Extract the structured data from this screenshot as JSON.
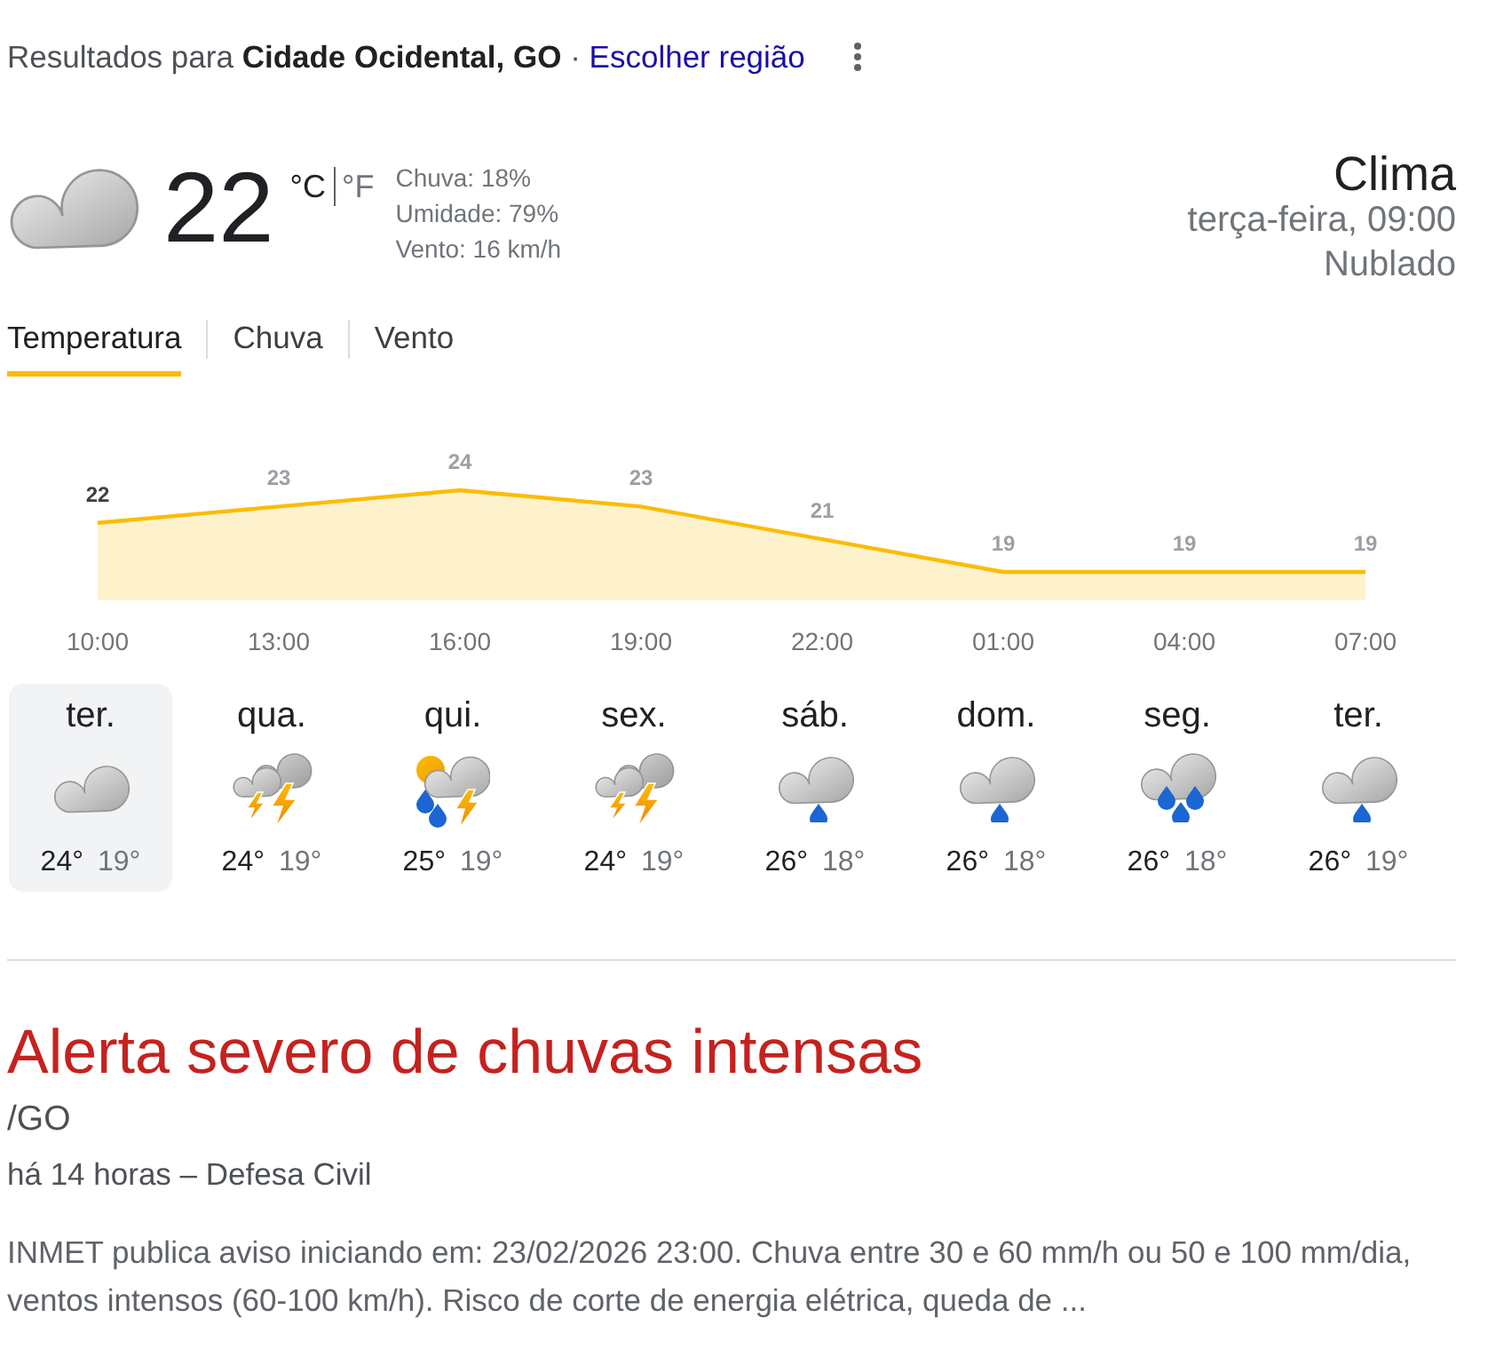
{
  "header": {
    "results_text": "Resultados para **Cidade Ocidental, GO** ·",
    "region_link": "Escolher região"
  },
  "current": {
    "kind": "cloudy",
    "temperature": "22",
    "units": [
      {
        "label": "°C",
        "selected": true
      },
      {
        "label": "°F",
        "selected": false
      }
    ],
    "details": [
      "Chuva: 18%",
      "Umidade: 79%",
      "Vento: 16 km/h"
    ]
  },
  "summary": {
    "title": "Clima",
    "datetime": "terça-feira, 09:00",
    "condition": "Nublado"
  },
  "tabs": [
    {
      "label": "Temperatura",
      "selected": true
    },
    {
      "label": "Chuva",
      "selected": false
    },
    {
      "label": "Vento",
      "selected": false
    }
  ],
  "hourly_chart": {
    "chart_data": {
      "type": "area",
      "categories": [
        "10:00",
        "13:00",
        "16:00",
        "19:00",
        "22:00",
        "01:00",
        "04:00",
        "07:00"
      ],
      "series": [
        {
          "color": "#fbbc04",
          "values": [
            22,
            23,
            24,
            23,
            21,
            19,
            19,
            19
          ]
        }
      ],
      "data_labels": true
    },
    "points": [
      {
        "selected": true
      },
      {
        "selected": false
      },
      {
        "selected": false
      },
      {
        "selected": false
      },
      {
        "selected": false
      },
      {
        "selected": false
      },
      {
        "selected": false
      },
      {
        "selected": false
      }
    ]
  },
  "forecast": {
    "days": [
      {
        "day": "ter.",
        "kind": "cloudy",
        "high": "24°",
        "low": "19°",
        "selected": true
      },
      {
        "day": "qua.",
        "kind": "storms",
        "high": "24°",
        "low": "19°",
        "selected": false
      },
      {
        "day": "qui.",
        "kind": "mixed",
        "high": "25°",
        "low": "19°",
        "selected": false
      },
      {
        "day": "sex.",
        "kind": "storms",
        "high": "24°",
        "low": "19°",
        "selected": false
      },
      {
        "day": "sáb.",
        "kind": "drizzle",
        "high": "26°",
        "low": "18°",
        "selected": false
      },
      {
        "day": "dom.",
        "kind": "drizzle",
        "high": "26°",
        "low": "18°",
        "selected": false
      },
      {
        "day": "seg.",
        "kind": "rain",
        "high": "26°",
        "low": "18°",
        "selected": false
      },
      {
        "day": "ter.",
        "kind": "drizzle",
        "high": "26°",
        "low": "19°",
        "selected": false
      }
    ]
  },
  "alert": {
    "title": "Alerta severo de chuvas intensas",
    "region": "/GO",
    "meta": "há 14 horas – Defesa Civil",
    "body": "INMET publica aviso iniciando em: 23/02/2026 23:00. Chuva entre 30 e 60 mm/h ou 50 e 100 mm/dia, ventos intensos (60-100 km/h). Risco de corte de energia elétrica, queda de ..."
  }
}
